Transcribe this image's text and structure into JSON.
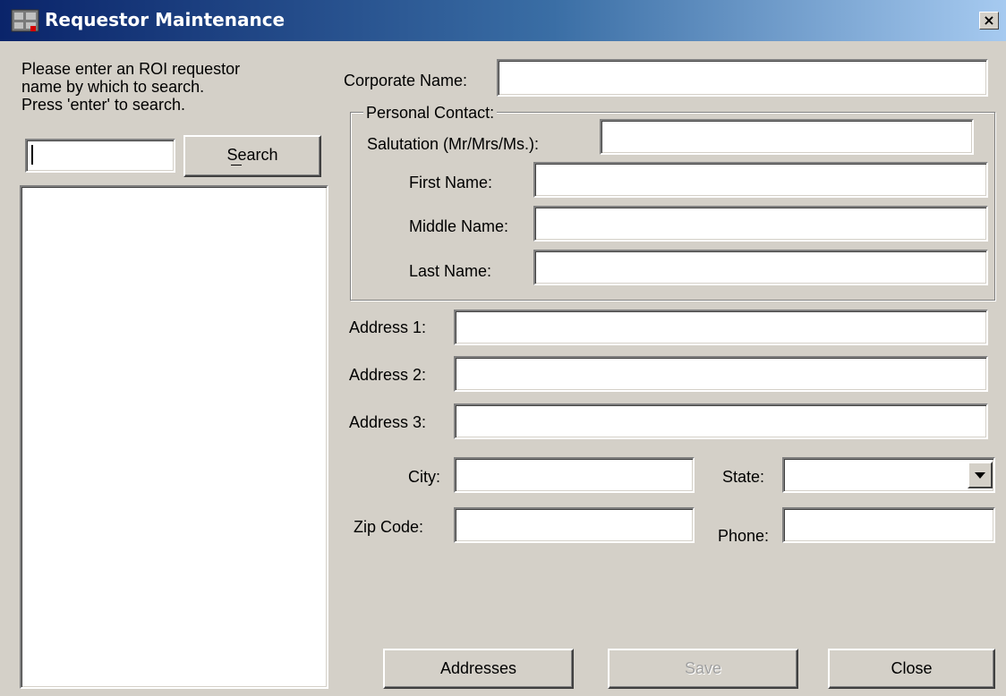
{
  "window": {
    "title": "Requestor Maintenance",
    "close_label": "×",
    "icon": "app-icon"
  },
  "search_panel": {
    "instructions": [
      "Please enter an ROI requestor",
      "name by which to search.",
      "Press 'enter' to search."
    ],
    "search_value": "",
    "search_button": "Search",
    "results": []
  },
  "form": {
    "corporate_name_label": "Corporate Name:",
    "personal_contact_legend": "Personal Contact:",
    "salutation_label": "Salutation (Mr/Mrs/Ms.):",
    "first_name_label": "First Name:",
    "middle_name_label": "Middle Name:",
    "last_name_label": "Last Name:",
    "address1_label": "Address 1:",
    "address2_label": "Address 2:",
    "address3_label": "Address 3:",
    "city_label": "City:",
    "state_label": "State:",
    "zip_label": "Zip Code:",
    "phone_label": "Phone:",
    "values": {
      "corporate_name": "",
      "salutation": "",
      "first_name": "",
      "middle_name": "",
      "last_name": "",
      "address1": "",
      "address2": "",
      "address3": "",
      "city": "",
      "state": "",
      "zip": "",
      "phone": ""
    }
  },
  "buttons": {
    "addresses": "Addresses",
    "save": "Save",
    "close": "Close"
  },
  "colors": {
    "face": "#d4d0c8",
    "title_start": "#0a246a",
    "title_end": "#a6caf0"
  }
}
